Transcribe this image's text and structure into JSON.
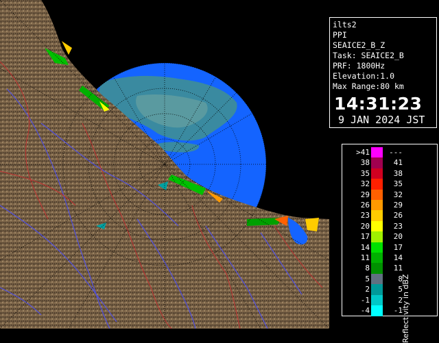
{
  "info": {
    "lines": [
      "ilts2",
      "PPI",
      "SEAICE2_B_Z",
      "Task: SEAICE2_B",
      "PRF: 1800Hz",
      "Elevation:1.0",
      "Max Range:80 km"
    ],
    "time": "14:31:23",
    "date": "9 JAN 2024 JST"
  },
  "legend": {
    "title": "Reflectivity in dBZ",
    "rows": [
      {
        "lo": ">41",
        "hi": "---",
        "color": "#ff00ff"
      },
      {
        "lo": "38",
        "hi": "41",
        "color": "#a0004f"
      },
      {
        "lo": "35",
        "hi": "38",
        "color": "#d00020"
      },
      {
        "lo": "32",
        "hi": "35",
        "color": "#ff2000"
      },
      {
        "lo": "29",
        "hi": "32",
        "color": "#ff6000"
      },
      {
        "lo": "26",
        "hi": "29",
        "color": "#ff9900"
      },
      {
        "lo": "23",
        "hi": "26",
        "color": "#ffcc00"
      },
      {
        "lo": "20",
        "hi": "23",
        "color": "#ffff00"
      },
      {
        "lo": "17",
        "hi": "20",
        "color": "#a0f000"
      },
      {
        "lo": "14",
        "hi": "17",
        "color": "#00e000"
      },
      {
        "lo": "11",
        "hi": "14",
        "color": "#00b000"
      },
      {
        "lo": "8",
        "hi": "11",
        "color": "#009000"
      },
      {
        "lo": "5",
        "hi": "8",
        "color": "#607080"
      },
      {
        "lo": "2",
        "hi": "5",
        "color": "#009999"
      },
      {
        "lo": "-1",
        "hi": "2",
        "color": "#00c8c8"
      },
      {
        "lo": "-4",
        "hi": "-1",
        "color": "#00ffff"
      }
    ]
  },
  "colors": {
    "sea": "#1464ff",
    "land": "#7a6448",
    "river": "#5050e0",
    "border": "#c03030"
  }
}
